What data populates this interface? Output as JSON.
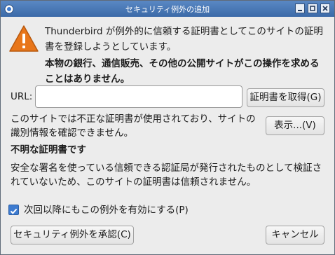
{
  "window": {
    "title": "セキュリティ例外の追加"
  },
  "message": {
    "line1": "Thunderbird が例外的に信頼する証明書としてこのサイトの証明",
    "line2": "書を登録しようとしています。",
    "warning_line1": "本物の銀行、通信販売、その他の公開サイトがこの操作を求める",
    "warning_line2": "ことはありません。"
  },
  "url": {
    "label": "URL:",
    "value": "",
    "get_cert_button": "証明書を取得(G)"
  },
  "cert_status": {
    "line1": "このサイトでは不正な証明書が使用されており、サイトの",
    "line2": "識別情報を確認できません。",
    "view_button": "表示...(V)"
  },
  "unknown_cert": {
    "heading": "不明な証明書です",
    "line1": "安全な署名を使っている信頼できる認証局が発行されたものとして検証さ",
    "line2": "れていないため、このサイトの証明書は信頼されません。"
  },
  "permanent": {
    "label": "次回以降にもこの例外を有効にする(P)",
    "checked": true
  },
  "buttons": {
    "confirm": "セキュリティ例外を承認(C)",
    "cancel": "キャンセル"
  },
  "colors": {
    "titlebar": "#3b6aa8",
    "accent": "#3d7bd0",
    "warning": "#e8761a"
  }
}
